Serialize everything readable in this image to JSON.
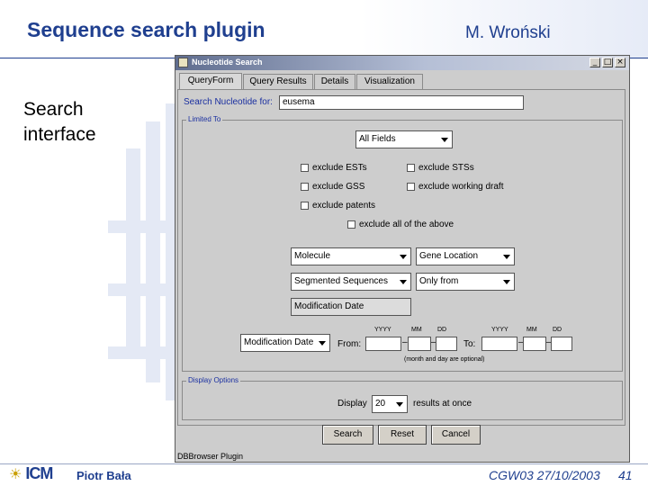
{
  "slide": {
    "title": "Sequence search plugin",
    "author": "M. Wroński",
    "side_label_line1": "Search",
    "side_label_line2": "interface"
  },
  "footer": {
    "logo_text": "ICM",
    "name": "Piotr Bała",
    "conference": "CGW03 27/10/2003",
    "page": "41"
  },
  "window": {
    "title": "Nucleotide Search",
    "buttons": {
      "minimize": "_",
      "maximize": "□",
      "close": "×"
    },
    "tabs": [
      "QueryForm",
      "Query Results",
      "Details",
      "Visualization"
    ],
    "active_tab": "QueryForm",
    "search_label": "Search Nucleotide for:",
    "search_value": "eusema",
    "limited_to_title": "Limited To",
    "all_fields": "All Fields",
    "checkboxes": {
      "exclude_ests": "exclude ESTs",
      "exclude_stss": "exclude STSs",
      "exclude_gss": "exclude GSS",
      "exclude_working_draft": "exclude working draft",
      "exclude_patents": "exclude patents",
      "exclude_all": "exclude all of the above"
    },
    "molecule": "Molecule",
    "gene_location": "Gene Location",
    "segmented_sequences": "Segmented Sequences",
    "only_from": "Only from",
    "modification_date": "Modification Date",
    "date_type": "Modification Date",
    "from_label": "From:",
    "to_label": "To:",
    "date_headers": {
      "yyyy": "YYYY",
      "mm": "MM",
      "dd": "DD"
    },
    "date_note": "(month and day are optional)",
    "display_options_title": "Display Options",
    "display_label": "Display",
    "display_value": "20",
    "display_suffix": "results at once",
    "btn_search": "Search",
    "btn_reset": "Reset",
    "btn_cancel": "Cancel",
    "status": "DBBrowser Plugin"
  }
}
